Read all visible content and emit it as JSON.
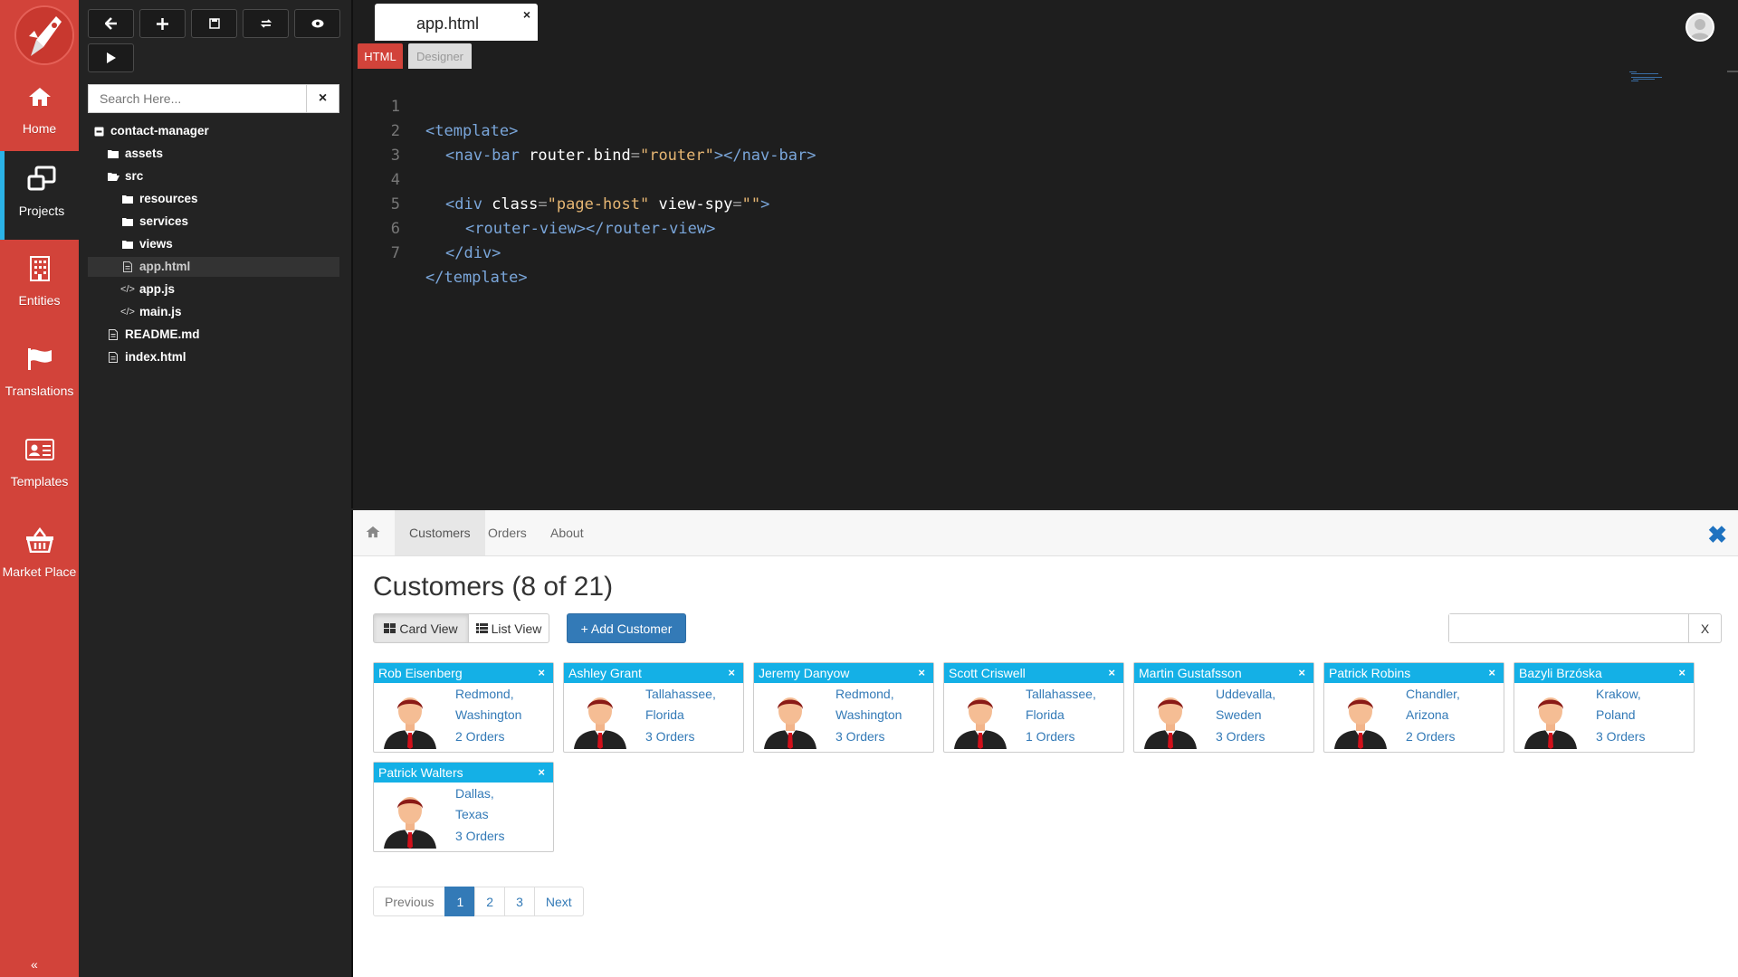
{
  "sidebar": {
    "items": [
      {
        "label": "Home",
        "icon": "home-icon"
      },
      {
        "label": "Projects",
        "icon": "projects-icon"
      },
      {
        "label": "Entities",
        "icon": "building-icon"
      },
      {
        "label": "Translations",
        "icon": "flag-icon"
      },
      {
        "label": "Templates",
        "icon": "id-card-icon"
      },
      {
        "label": "Market Place",
        "icon": "basket-icon"
      }
    ],
    "active": "Projects",
    "collapse_label": "«"
  },
  "toolbar": {
    "buttons": [
      "back-arrow-icon",
      "plus-icon",
      "save-icon",
      "refresh-icon",
      "eye-icon",
      "play-icon"
    ]
  },
  "explorer": {
    "search_placeholder": "Search Here...",
    "search_clear": "×",
    "tree": [
      {
        "label": "contact-manager",
        "icon": "minus-square-icon",
        "level": 0
      },
      {
        "label": "assets",
        "icon": "folder-icon",
        "level": 1
      },
      {
        "label": "src",
        "icon": "folder-open-icon",
        "level": 1
      },
      {
        "label": "resources",
        "icon": "folder-icon",
        "level": 2
      },
      {
        "label": "services",
        "icon": "folder-icon",
        "level": 2
      },
      {
        "label": "views",
        "icon": "folder-icon",
        "level": 2
      },
      {
        "label": "app.html",
        "icon": "html-file-icon",
        "level": 2,
        "selected": true
      },
      {
        "label": "app.js",
        "icon": "code-icon",
        "level": 2
      },
      {
        "label": "main.js",
        "icon": "code-icon",
        "level": 2
      },
      {
        "label": "README.md",
        "icon": "file-icon",
        "level": 1
      },
      {
        "label": "index.html",
        "icon": "html-file-icon",
        "level": 1
      }
    ]
  },
  "editor": {
    "tab_label": "app.html",
    "tab_close": "×",
    "modes": {
      "html": "HTML",
      "designer": "Designer"
    },
    "line_numbers": [
      "1",
      "2",
      "3",
      "4",
      "5",
      "6",
      "7"
    ],
    "code": {
      "l1_open": "<template>",
      "l2_tag_open": "<nav-bar ",
      "l2_attr": "router.bind",
      "l2_eq": "=",
      "l2_val": "\"router\"",
      "l2_close": "></nav-bar>",
      "l4_tag_open": "<div ",
      "l4_attr1": "class",
      "l4_eq1": "=",
      "l4_val1": "\"page-host\"",
      "l4_attr2": " view-spy",
      "l4_eq2": "=",
      "l4_val2": "\"\"",
      "l4_close": ">",
      "l5": "<router-view></router-view>",
      "l6": "</div>",
      "l7": "</template>"
    }
  },
  "preview": {
    "nav": {
      "customers": "Customers",
      "orders": "Orders",
      "about": "About",
      "active": "Customers"
    },
    "title": "Customers (8 of 21)",
    "buttons": {
      "card_view": "Card View",
      "list_view": "List View",
      "add_customer": "+ Add Customer"
    },
    "filter_clear": "X",
    "close_label": "✖",
    "customers": [
      {
        "name": "Rob Eisenberg",
        "city": "Redmond,",
        "region": "Washington",
        "orders": "2 Orders"
      },
      {
        "name": "Ashley Grant",
        "city": "Tallahassee,",
        "region": "Florida",
        "orders": "3 Orders"
      },
      {
        "name": "Jeremy Danyow",
        "city": "Redmond,",
        "region": "Washington",
        "orders": "3 Orders"
      },
      {
        "name": "Scott Criswell",
        "city": "Tallahassee,",
        "region": "Florida",
        "orders": "1 Orders"
      },
      {
        "name": "Martin Gustafsson",
        "city": "Uddevalla,",
        "region": "Sweden",
        "orders": "3 Orders"
      },
      {
        "name": "Patrick Robins",
        "city": "Chandler,",
        "region": "Arizona",
        "orders": "2 Orders"
      },
      {
        "name": "Bazyli Brzóska",
        "city": "Krakow,",
        "region": "Poland",
        "orders": "3 Orders"
      },
      {
        "name": "Patrick Walters",
        "city": "Dallas,",
        "region": "Texas",
        "orders": "3 Orders"
      }
    ],
    "card_close": "×",
    "pagination": {
      "previous": "Previous",
      "pages": [
        "1",
        "2",
        "3"
      ],
      "active_page": "1",
      "next": "Next"
    }
  },
  "colors": {
    "sidebar_red": "#d2433a",
    "accent_blue": "#14b0e6",
    "primary_blue": "#337ab7",
    "editor_bg": "#1e1e1e"
  }
}
